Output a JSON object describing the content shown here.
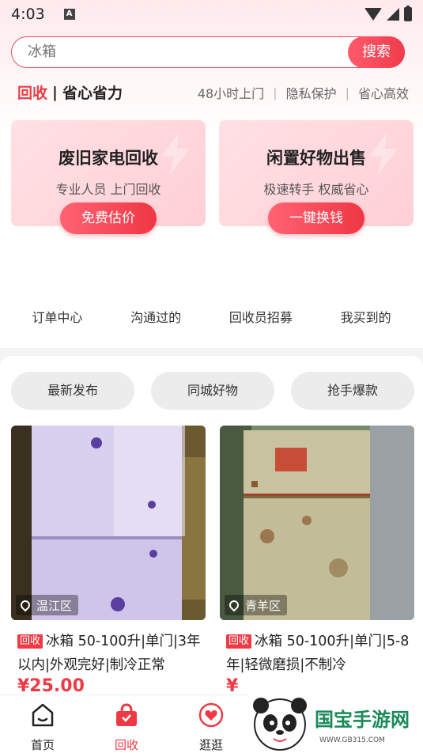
{
  "status_bar": {
    "time": "4:03",
    "notification": "A"
  },
  "search": {
    "placeholder": "冰箱",
    "button_label": "搜索"
  },
  "slogan": {
    "highlight": "回收",
    "separator": "|",
    "text": "省心省力"
  },
  "features": [
    "48小时上门",
    "隐私保护",
    "省心高效"
  ],
  "cards": [
    {
      "title": "废旧家电回收",
      "subtitle": "专业人员 上门回收",
      "button": "免费估价"
    },
    {
      "title": "闲置好物出售",
      "subtitle": "极速转手 权威省心",
      "button": "一键换钱"
    }
  ],
  "quick_nav": [
    "订单中心",
    "沟通过的",
    "回收员招募",
    "我买到的"
  ],
  "tabs": [
    "最新发布",
    "同城好物",
    "抢手爆款"
  ],
  "products": [
    {
      "location": "温江区",
      "badge": "回收",
      "title": "冰箱 50-100升|单门|3年以内|外观完好|制冷正常",
      "price": "¥25.00"
    },
    {
      "location": "青羊区",
      "badge": "回收",
      "title": "冰箱 50-100升|单门|5-8年|轻微磨损|不制冷",
      "price": "¥"
    }
  ],
  "bottom_nav": [
    {
      "label": "首页",
      "icon": "home-icon"
    },
    {
      "label": "回收",
      "icon": "gift-bag-icon"
    },
    {
      "label": "逛逛",
      "icon": "heart-icon"
    }
  ],
  "watermark": {
    "text": "国宝手游网",
    "url": "WWW.GB315.COM"
  },
  "colors": {
    "accent": "#ef3a45",
    "card_bg": "#ffd8dd",
    "tab_bg": "#ececec"
  }
}
